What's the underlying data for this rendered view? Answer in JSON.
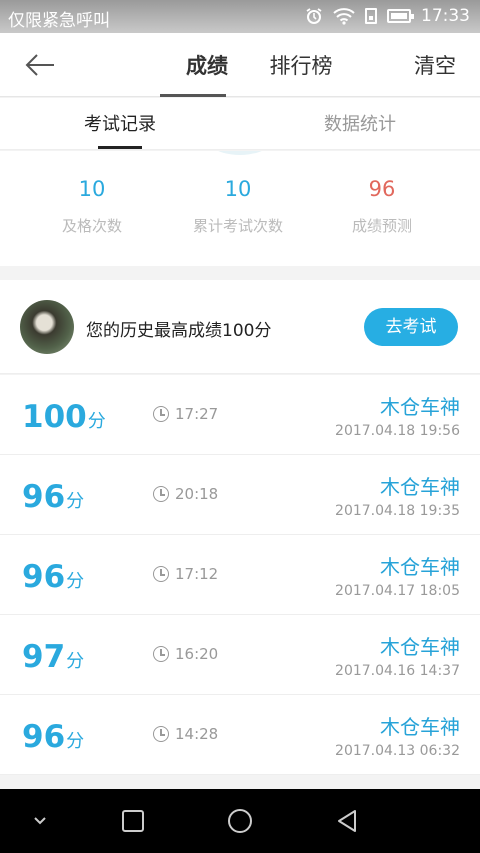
{
  "status_bar": {
    "carrier": "仅限紧急呼叫",
    "time": "17:33",
    "icons": [
      "alarm-icon",
      "wifi-icon",
      "sim-icon",
      "battery-icon"
    ]
  },
  "header": {
    "back_icon": "back-arrow-icon",
    "tabs": [
      {
        "label": "成绩",
        "active": true
      },
      {
        "label": "排行榜",
        "active": false
      }
    ],
    "clear_label": "清空"
  },
  "subtabs": [
    {
      "label": "考试记录",
      "active": true
    },
    {
      "label": "数据统计",
      "active": false
    }
  ],
  "stats": [
    {
      "value": "10",
      "label": "及格次数"
    },
    {
      "value": "10",
      "label": "累计考试次数"
    },
    {
      "value": "96",
      "label": "成绩预测"
    }
  ],
  "best": {
    "text": "您的历史最高成绩100分",
    "button_label": "去考试"
  },
  "records": [
    {
      "score": "100",
      "unit": "分",
      "duration": "17:27",
      "name": "木仓车神",
      "date": "2017.04.18  19:56"
    },
    {
      "score": "96",
      "unit": "分",
      "duration": "20:18",
      "name": "木仓车神",
      "date": "2017.04.18  19:35"
    },
    {
      "score": "96",
      "unit": "分",
      "duration": "17:12",
      "name": "木仓车神",
      "date": "2017.04.17  18:05"
    },
    {
      "score": "97",
      "unit": "分",
      "duration": "16:20",
      "name": "木仓车神",
      "date": "2017.04.16  14:37"
    },
    {
      "score": "96",
      "unit": "分",
      "duration": "14:28",
      "name": "木仓车神",
      "date": "2017.04.13  06:32"
    }
  ],
  "colors": {
    "accent": "#27aee3",
    "prediction": "#e1685d"
  }
}
